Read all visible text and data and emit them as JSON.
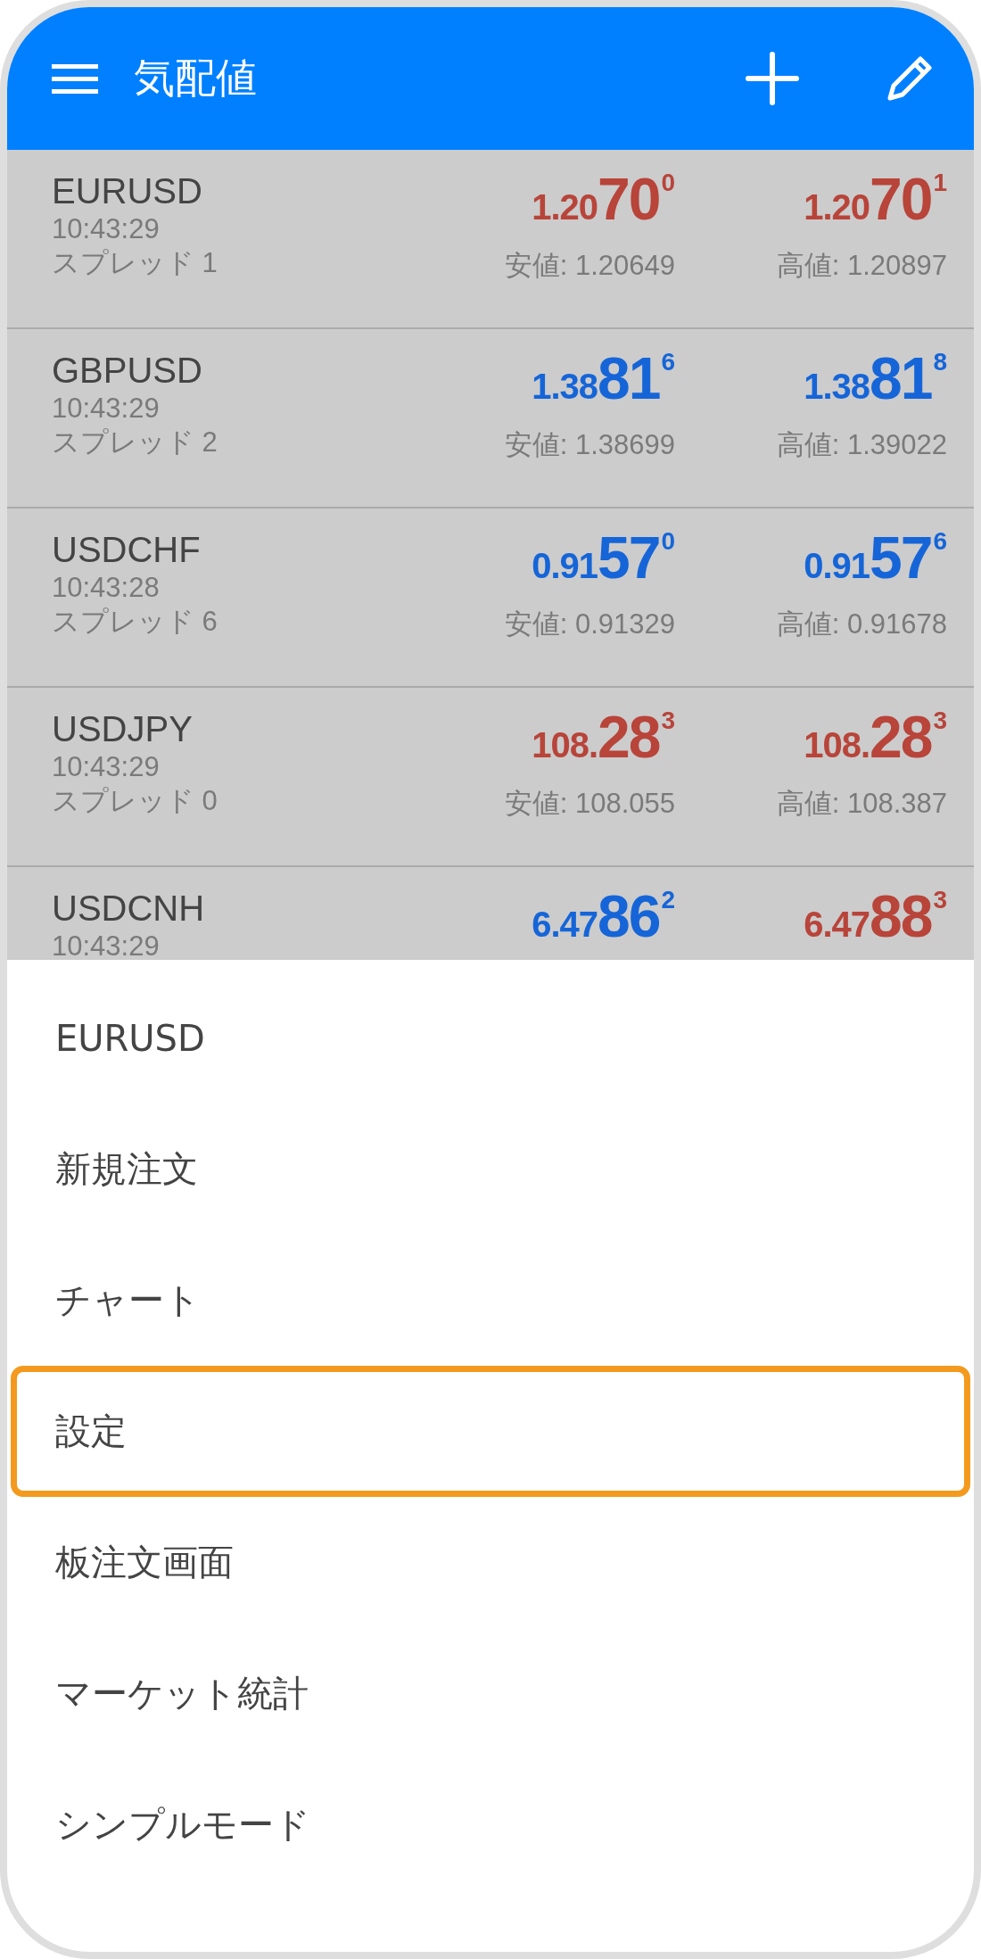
{
  "header": {
    "title": "気配値"
  },
  "quotes": [
    {
      "symbol": "EURUSD",
      "time": "10:43:29",
      "spread": "スプレッド 1",
      "bid": {
        "prefix": "1.20",
        "big": "70",
        "sup": "0",
        "rising": false
      },
      "ask": {
        "prefix": "1.20",
        "big": "70",
        "sup": "1",
        "rising": false
      },
      "low": "安値: 1.20649",
      "high": "高値: 1.20897"
    },
    {
      "symbol": "GBPUSD",
      "time": "10:43:29",
      "spread": "スプレッド 2",
      "bid": {
        "prefix": "1.38",
        "big": "81",
        "sup": "6",
        "rising": true
      },
      "ask": {
        "prefix": "1.38",
        "big": "81",
        "sup": "8",
        "rising": true
      },
      "low": "安値: 1.38699",
      "high": "高値: 1.39022"
    },
    {
      "symbol": "USDCHF",
      "time": "10:43:28",
      "spread": "スプレッド 6",
      "bid": {
        "prefix": "0.91",
        "big": "57",
        "sup": "0",
        "rising": true
      },
      "ask": {
        "prefix": "0.91",
        "big": "57",
        "sup": "6",
        "rising": true
      },
      "low": "安値: 0.91329",
      "high": "高値: 0.91678"
    },
    {
      "symbol": "USDJPY",
      "time": "10:43:29",
      "spread": "スプレッド 0",
      "bid": {
        "prefix": "108.",
        "big": "28",
        "sup": "3",
        "rising": false
      },
      "ask": {
        "prefix": "108.",
        "big": "28",
        "sup": "3",
        "rising": false
      },
      "low": "安値: 108.055",
      "high": "高値: 108.387"
    },
    {
      "symbol": "USDCNH",
      "time": "10:43:29",
      "bid": {
        "prefix": "6.47",
        "big": "86",
        "sup": "2",
        "rising": true
      },
      "ask": {
        "prefix": "6.47",
        "big": "88",
        "sup": "3",
        "rising": false
      }
    }
  ],
  "menu": [
    {
      "label": "EURUSD",
      "highlighted": false
    },
    {
      "label": "新規注文",
      "highlighted": false
    },
    {
      "label": "チャート",
      "highlighted": false
    },
    {
      "label": "設定",
      "highlighted": true
    },
    {
      "label": "板注文画面",
      "highlighted": false
    },
    {
      "label": "マーケット統計",
      "highlighted": false
    },
    {
      "label": "シンプルモード",
      "highlighted": false
    }
  ]
}
